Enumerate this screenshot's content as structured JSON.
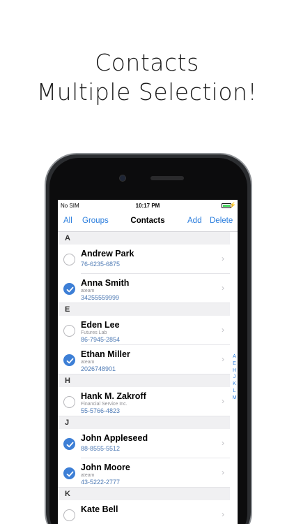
{
  "headline": {
    "line1": "Contacts",
    "line2": "Multiple Selection!"
  },
  "status": {
    "carrier": "No SIM",
    "time": "10:17 PM",
    "battery_level": 1.0,
    "charging": true
  },
  "nav": {
    "all": "All",
    "groups": "Groups",
    "title": "Contacts",
    "add": "Add",
    "delete": "Delete"
  },
  "sections": [
    {
      "letter": "A",
      "contacts": [
        {
          "name": "Andrew Park",
          "company": "",
          "phone": "76-6235-6875",
          "selected": false
        },
        {
          "name": "Anna Smith",
          "company": "ateam",
          "phone": "34255559999",
          "selected": true
        }
      ]
    },
    {
      "letter": "E",
      "contacts": [
        {
          "name": "Eden Lee",
          "company": "Futures Lab",
          "phone": "86-7945-2854",
          "selected": false
        },
        {
          "name": "Ethan Miller",
          "company": "ateam",
          "phone": "2026748901",
          "selected": true
        }
      ]
    },
    {
      "letter": "H",
      "contacts": [
        {
          "name": "Hank M. Zakroff",
          "company": "Financial Service Inc.",
          "phone": "55-5766-4823",
          "selected": false
        }
      ]
    },
    {
      "letter": "J",
      "contacts": [
        {
          "name": "John Appleseed",
          "company": "",
          "phone": "88-8555-5512",
          "selected": true
        },
        {
          "name": "John Moore",
          "company": "ateam",
          "phone": "43-5222-2777",
          "selected": true
        }
      ]
    },
    {
      "letter": "K",
      "contacts": [
        {
          "name": "Kate Bell",
          "company": "",
          "phone": "",
          "selected": false
        }
      ]
    }
  ],
  "index_letters": [
    "A",
    "E",
    "H",
    "J",
    "K",
    "L",
    "M"
  ],
  "colors": {
    "accent": "#2a7ddd",
    "check": "#3d7fd6",
    "phone_text": "#4f7bb5",
    "section_bg": "#f0f0f2"
  },
  "icons": {
    "check": "checkmark-icon",
    "chevron": "chevron-right-icon"
  }
}
